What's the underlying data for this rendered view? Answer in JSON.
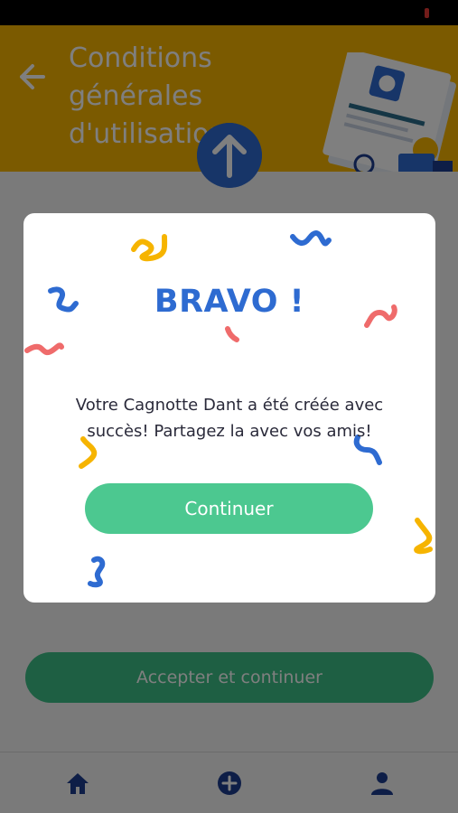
{
  "status_bar": {
    "indicator_color": "#e53935"
  },
  "header": {
    "title": "Conditions générales d'utilisation",
    "background_color": "#f6b400",
    "back_icon": "back-arrow-icon",
    "illustration": "documents-illustration"
  },
  "scroll_button": {
    "icon": "arrow-up-icon",
    "color": "#2e6bd1"
  },
  "footer": {
    "accept_label": "Accepter et continuer",
    "accept_color": "#3dbf86"
  },
  "bottom_nav": {
    "items": [
      {
        "icon": "home-icon"
      },
      {
        "icon": "add-circle-icon"
      },
      {
        "icon": "user-icon"
      }
    ],
    "icon_color": "#1d3d8f"
  },
  "modal": {
    "title": "BRAVO !",
    "message": "Votre Cagnotte Dant a été créée avec succès! Partagez la avec vos amis!",
    "continue_label": "Continuer",
    "title_color": "#2e6bd1",
    "button_color": "#4cc890",
    "confetti_colors": [
      "#f6b400",
      "#2e6bd1",
      "#ef6b6b"
    ]
  }
}
